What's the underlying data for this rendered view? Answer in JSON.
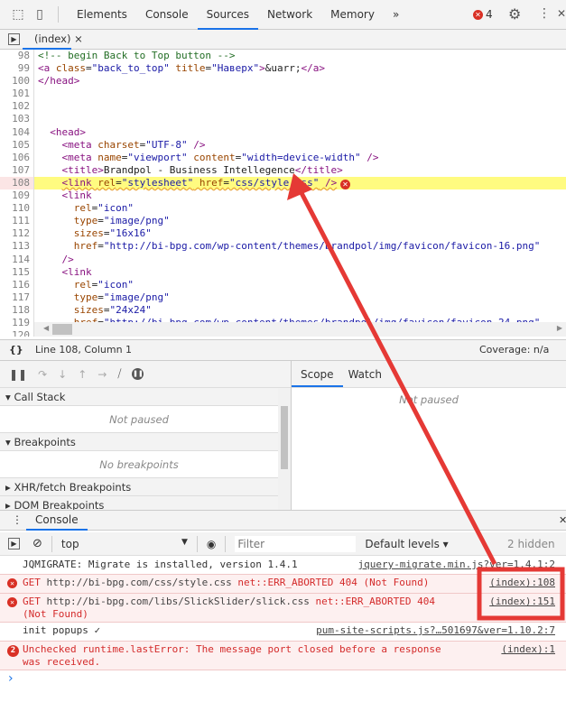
{
  "toolbar": {
    "tabs": [
      "Elements",
      "Console",
      "Sources",
      "Network",
      "Memory"
    ],
    "active": "Sources",
    "more": "»",
    "error_count": "4",
    "icons": [
      "inspect-icon",
      "device-icon",
      "gear-icon",
      "kebab-icon",
      "close-icon"
    ]
  },
  "file_tab": {
    "label": "(index)",
    "close": "×"
  },
  "code": [
    {
      "n": "98",
      "t": [
        [
          "c",
          "<!-- begin Back to Top button -->"
        ]
      ]
    },
    {
      "n": "99",
      "t": [
        [
          "t",
          "<a "
        ],
        [
          "a",
          "class"
        ],
        [
          "x",
          "="
        ],
        [
          "v",
          "\"back_to_top\""
        ],
        [
          "x",
          " "
        ],
        [
          "a",
          "title"
        ],
        [
          "x",
          "="
        ],
        [
          "v",
          "\"Наверх\""
        ],
        [
          "t",
          ">"
        ],
        [
          "x",
          "&uarr;"
        ],
        [
          "t",
          "</a>"
        ]
      ]
    },
    {
      "n": "100",
      "t": [
        [
          "t",
          "</head>"
        ]
      ]
    },
    {
      "n": "101",
      "t": []
    },
    {
      "n": "102",
      "t": []
    },
    {
      "n": "103",
      "t": []
    },
    {
      "n": "104",
      "t": [
        [
          "x",
          "  "
        ],
        [
          "t",
          "<head>"
        ]
      ]
    },
    {
      "n": "105",
      "t": [
        [
          "x",
          "    "
        ],
        [
          "t",
          "<meta "
        ],
        [
          "a",
          "charset"
        ],
        [
          "x",
          "="
        ],
        [
          "v",
          "\"UTF-8\""
        ],
        [
          "t",
          " />"
        ]
      ]
    },
    {
      "n": "106",
      "t": [
        [
          "x",
          "    "
        ],
        [
          "t",
          "<meta "
        ],
        [
          "a",
          "name"
        ],
        [
          "x",
          "="
        ],
        [
          "v",
          "\"viewport\""
        ],
        [
          "x",
          " "
        ],
        [
          "a",
          "content"
        ],
        [
          "x",
          "="
        ],
        [
          "v",
          "\"width=device-width\""
        ],
        [
          "t",
          " />"
        ]
      ]
    },
    {
      "n": "107",
      "t": [
        [
          "x",
          "    "
        ],
        [
          "t",
          "<title>"
        ],
        [
          "x",
          "Brandpol - Business Intellegence"
        ],
        [
          "t",
          "</title>"
        ]
      ]
    },
    {
      "n": "108",
      "hl": true,
      "t": [
        [
          "x",
          "    "
        ],
        [
          "t",
          "<link "
        ],
        [
          "a",
          "rel"
        ],
        [
          "x",
          "="
        ],
        [
          "v",
          "\"stylesheet\""
        ],
        [
          "x",
          " "
        ],
        [
          "a",
          "href"
        ],
        [
          "x",
          "="
        ],
        [
          "v",
          "\"css/style.css\""
        ],
        [
          "t",
          " />"
        ]
      ]
    },
    {
      "n": "109",
      "t": [
        [
          "x",
          "    "
        ],
        [
          "t",
          "<link"
        ]
      ]
    },
    {
      "n": "110",
      "t": [
        [
          "x",
          "      "
        ],
        [
          "a",
          "rel"
        ],
        [
          "x",
          "="
        ],
        [
          "v",
          "\"icon\""
        ]
      ]
    },
    {
      "n": "111",
      "t": [
        [
          "x",
          "      "
        ],
        [
          "a",
          "type"
        ],
        [
          "x",
          "="
        ],
        [
          "v",
          "\"image/png\""
        ]
      ]
    },
    {
      "n": "112",
      "t": [
        [
          "x",
          "      "
        ],
        [
          "a",
          "sizes"
        ],
        [
          "x",
          "="
        ],
        [
          "v",
          "\"16x16\""
        ]
      ]
    },
    {
      "n": "113",
      "t": [
        [
          "x",
          "      "
        ],
        [
          "a",
          "href"
        ],
        [
          "x",
          "="
        ],
        [
          "v",
          "\"http://bi-bpg.com/wp-content/themes/brandpol/img/favicon/favicon-16.png\""
        ]
      ]
    },
    {
      "n": "114",
      "t": [
        [
          "x",
          "    "
        ],
        [
          "t",
          "/>"
        ]
      ]
    },
    {
      "n": "115",
      "t": [
        [
          "x",
          "    "
        ],
        [
          "t",
          "<link"
        ]
      ]
    },
    {
      "n": "116",
      "t": [
        [
          "x",
          "      "
        ],
        [
          "a",
          "rel"
        ],
        [
          "x",
          "="
        ],
        [
          "v",
          "\"icon\""
        ]
      ]
    },
    {
      "n": "117",
      "t": [
        [
          "x",
          "      "
        ],
        [
          "a",
          "type"
        ],
        [
          "x",
          "="
        ],
        [
          "v",
          "\"image/png\""
        ]
      ]
    },
    {
      "n": "118",
      "t": [
        [
          "x",
          "      "
        ],
        [
          "a",
          "sizes"
        ],
        [
          "x",
          "="
        ],
        [
          "v",
          "\"24x24\""
        ]
      ]
    },
    {
      "n": "119",
      "t": [
        [
          "x",
          "      "
        ],
        [
          "a",
          "href"
        ],
        [
          "x",
          "="
        ],
        [
          "v",
          "\"http://bi-bpg.com/wp-content/themes/brandpol/img/favicon/favicon-24.png\""
        ]
      ]
    },
    {
      "n": "120",
      "t": []
    }
  ],
  "status": {
    "position": "Line 108, Column 1",
    "coverage": "Coverage: n/a",
    "format_icon": "{}"
  },
  "sidebar": {
    "call_stack": "Call Stack",
    "call_stack_body": "Not paused",
    "breakpoints": "Breakpoints",
    "breakpoints_body": "No breakpoints",
    "xhr": "XHR/fetch Breakpoints",
    "dom": "DOM Breakpoints"
  },
  "scope": {
    "tabs": [
      "Scope",
      "Watch"
    ],
    "body": "Not paused"
  },
  "drawer": {
    "tab": "Console"
  },
  "console_toolbar": {
    "context": "top",
    "filter_placeholder": "Filter",
    "levels": "Default levels ▾",
    "hidden": "2 hidden"
  },
  "messages": [
    {
      "type": "log",
      "text": "JQMIGRATE: Migrate is installed, version 1.4.1",
      "src": "jquery-migrate.min.js?ver=1.4.1:2"
    },
    {
      "type": "error",
      "pre": "GET ",
      "url": "http://bi-bpg.com/css/style.css",
      "post": " net::ERR_ABORTED 404 (Not Found)",
      "src": "(index):108"
    },
    {
      "type": "error",
      "pre": "GET ",
      "url": "http://bi-bpg.com/libs/SlickSlider/slick.css",
      "post": " net::ERR_ABORTED 404 (Not Found)",
      "src": "(index):151"
    },
    {
      "type": "log",
      "text": "init popups ✓",
      "src": "pum-site-scripts.js?…501697&ver=1.10.2:7"
    },
    {
      "type": "error",
      "count": "2",
      "text": "Unchecked runtime.lastError: The message port closed before a response was received.",
      "src": "(index):1"
    }
  ],
  "prompt": "›",
  "colors": {
    "accent": "#1a73e8",
    "error": "#d93025",
    "highlight": "#fffb80",
    "annotation": "#e53935"
  }
}
